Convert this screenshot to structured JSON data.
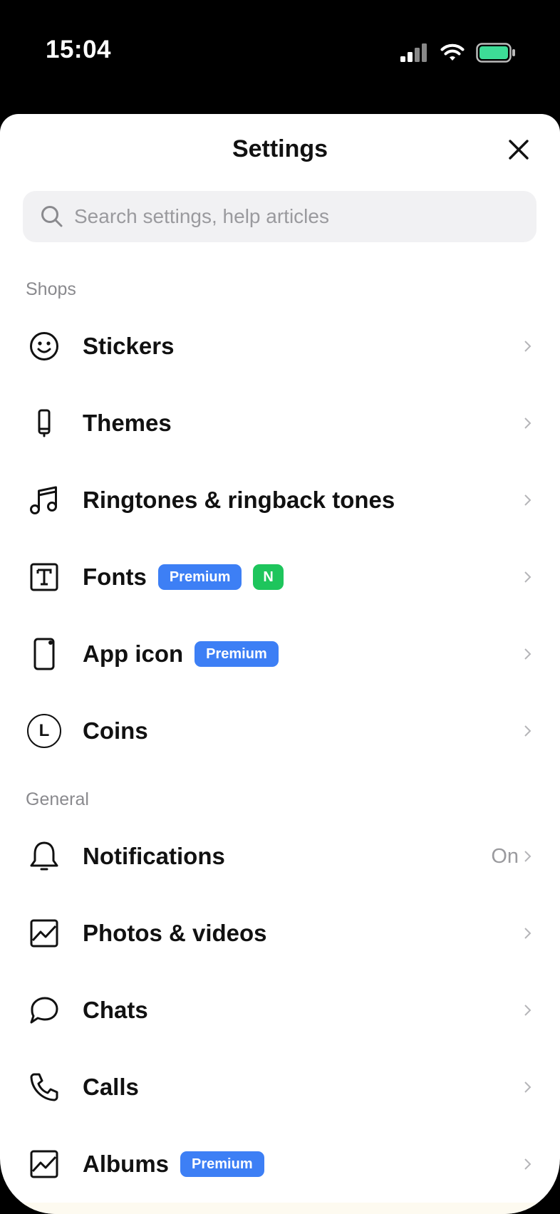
{
  "status_bar": {
    "time": "15:04"
  },
  "header": {
    "title": "Settings"
  },
  "search": {
    "placeholder": "Search settings, help articles"
  },
  "sections": {
    "shops": "Shops",
    "general": "General"
  },
  "shops_items": [
    {
      "label": "Stickers",
      "icon": "smiley-icon"
    },
    {
      "label": "Themes",
      "icon": "phone-brush-icon"
    },
    {
      "label": "Ringtones & ringback tones",
      "icon": "music-note-icon"
    },
    {
      "label": "Fonts",
      "icon": "font-t-icon",
      "badges": [
        "Premium",
        "N"
      ]
    },
    {
      "label": "App icon",
      "icon": "app-icon-icon",
      "badges": [
        "Premium"
      ]
    },
    {
      "label": "Coins",
      "icon": "coin-icon",
      "icon_text": "L"
    }
  ],
  "general_items": [
    {
      "label": "Notifications",
      "icon": "bell-icon",
      "value": "On"
    },
    {
      "label": "Photos & videos",
      "icon": "photo-icon"
    },
    {
      "label": "Chats",
      "icon": "chat-bubble-icon"
    },
    {
      "label": "Calls",
      "icon": "phone-icon"
    },
    {
      "label": "Albums",
      "icon": "album-icon",
      "badges": [
        "Premium"
      ]
    }
  ],
  "colors": {
    "premium_badge": "#3d7ff5",
    "new_badge": "#1ec55c",
    "battery": "#3ddc97"
  }
}
